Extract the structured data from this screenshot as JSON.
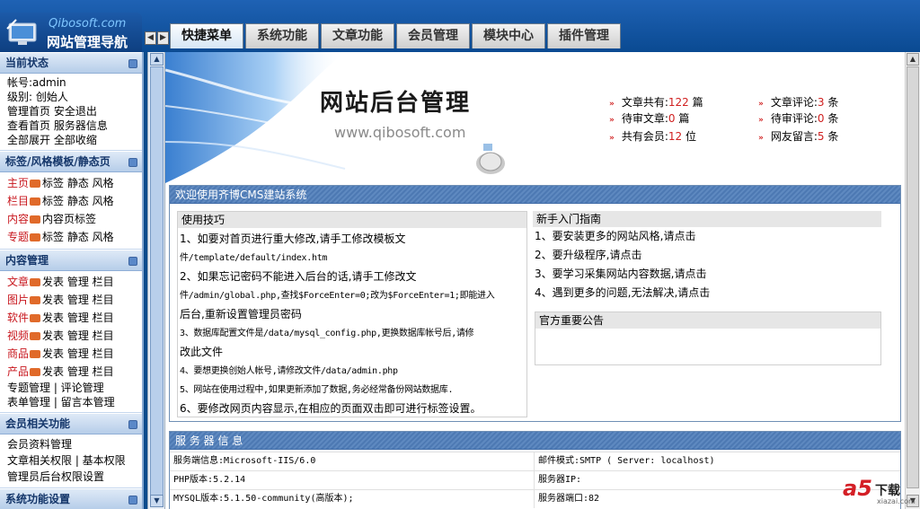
{
  "header": {
    "brand": "Qibosoft.com",
    "title": "网站管理导航",
    "tabs": [
      "快捷菜单",
      "系统功能",
      "文章功能",
      "会员管理",
      "模块中心",
      "插件管理"
    ],
    "active_tab": "快捷菜单"
  },
  "sidebar": {
    "status": {
      "title": "当前状态",
      "account_label": "帐号:",
      "account": "admin",
      "level": "级别: 创始人",
      "links1": "管理首页 安全退出",
      "links2": "查看首页 服务器信息",
      "links3": "全部展开 全部收缩"
    },
    "tags": {
      "title": "标签/风格模板/静态页",
      "rows": [
        {
          "name": "主页",
          "actions": "标签 静态 风格"
        },
        {
          "name": "栏目",
          "actions": "标签 静态 风格"
        },
        {
          "name": "内容",
          "actions": "内容页标签"
        },
        {
          "name": "专题",
          "actions": "标签 静态 风格"
        }
      ]
    },
    "content": {
      "title": "内容管理",
      "rows": [
        {
          "name": "文章",
          "actions": "发表 管理 栏目"
        },
        {
          "name": "图片",
          "actions": "发表 管理 栏目"
        },
        {
          "name": "软件",
          "actions": "发表 管理 栏目"
        },
        {
          "name": "视频",
          "actions": "发表 管理 栏目"
        },
        {
          "name": "商品",
          "actions": "发表 管理 栏目"
        },
        {
          "name": "产品",
          "actions": "发表 管理 栏目"
        }
      ],
      "extra1": "专题管理 | 评论管理",
      "extra2": "表单管理 | 留言本管理"
    },
    "member": {
      "title": "会员相关功能",
      "line1": "会员资料管理",
      "line2": "文章相关权限 | 基本权限",
      "line3": "管理员后台权限设置"
    },
    "system": {
      "title": "系统功能设置"
    }
  },
  "banner": {
    "title": "网站后台管理",
    "url": "www.qibosoft.com"
  },
  "stats": [
    {
      "label": "文章共有:",
      "value": "122",
      "unit": "篇"
    },
    {
      "label": "文章评论:",
      "value": "3",
      "unit": "条"
    },
    {
      "label": "待审文章:",
      "value": "0",
      "unit": "篇"
    },
    {
      "label": "待审评论:",
      "value": "0",
      "unit": "条"
    },
    {
      "label": "共有会员:",
      "value": "12",
      "unit": "位"
    },
    {
      "label": "网友留言:",
      "value": "5",
      "unit": "条"
    }
  ],
  "welcome": {
    "title": "欢迎使用齐博CMS建站系统",
    "tips_title": "使用技巧",
    "tips": [
      "1、如要对首页进行重大修改,请手工修改模板文",
      "件/template/default/index.htm",
      "2、如果忘记密码不能进入后台的话,请手工修改文",
      "件/admin/global.php,查找$ForceEnter=0;改为$ForceEnter=1;即能进入",
      "后台,重新设置管理员密码",
      "3、数据库配置文件是/data/mysql_config.php,更换数据库帐号后,请修",
      "改此文件",
      "4、要想更换创始人帐号,请修改文件/data/admin.php",
      "5、网站在使用过程中,如果更新添加了数据,务必经常备份网站数据库.",
      "6、要修改网页内容显示,在相应的页面双击即可进行标签设置。"
    ],
    "guide_title": "新手入门指南",
    "guide": [
      "1、要安装更多的网站风格,请点击",
      "2、要升级程序,请点击",
      "3、要学习采集网站内容数据,请点击",
      "4、遇到更多的问题,无法解决,请点击"
    ],
    "notice_title": "官方重要公告"
  },
  "server": {
    "title": "服 务 器 信 息",
    "rows": [
      [
        "服务端信息:Microsoft-IIS/6.0",
        "邮件模式:SMTP ( Server: localhost)"
      ],
      [
        "PHP版本:5.2.14",
        "服务器IP:"
      ],
      [
        "MYSQL版本:5.1.50-community(高版本);",
        "服务器端口:82"
      ]
    ]
  },
  "watermark": {
    "logo": "a5",
    "text": "下载",
    "site": "xiazai.com"
  }
}
